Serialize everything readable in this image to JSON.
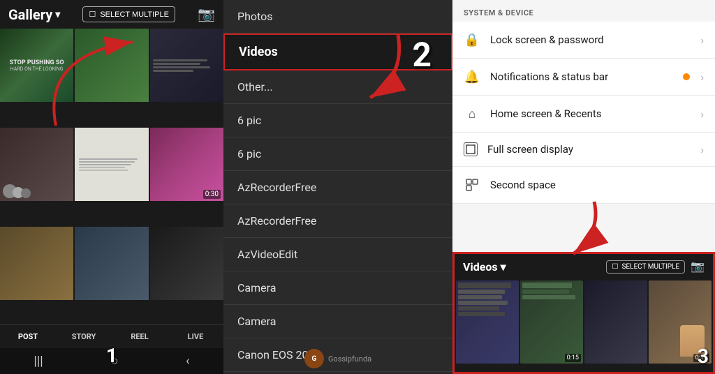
{
  "section1": {
    "header": {
      "title": "Gallery",
      "select_multiple": "SELECT MULTIPLE",
      "chevron": "▾"
    },
    "bottom_tabs": [
      "POST",
      "STORY",
      "REEL",
      "LIVE"
    ],
    "step_number": "1",
    "android_nav": [
      "|||",
      "○",
      "‹"
    ]
  },
  "section2": {
    "step_number": "2",
    "menu_items": [
      {
        "label": "Photos",
        "highlighted": false
      },
      {
        "label": "Videos",
        "highlighted": true
      },
      {
        "label": "Other...",
        "highlighted": false
      },
      {
        "label": "6 pic",
        "highlighted": false
      },
      {
        "label": "6 pic",
        "highlighted": false
      },
      {
        "label": "AzRecorderFree",
        "highlighted": false
      },
      {
        "label": "AzRecorderFree",
        "highlighted": false
      },
      {
        "label": "AzVideoEdit",
        "highlighted": false
      },
      {
        "label": "Camera",
        "highlighted": false
      },
      {
        "label": "Camera",
        "highlighted": false
      },
      {
        "label": "Canon EOS 200D",
        "highlighted": false
      }
    ],
    "watermark": "Gossipfunda"
  },
  "section3": {
    "section_label": "SYSTEM & DEVICE",
    "settings_items": [
      {
        "icon": "🔒",
        "label": "Lock screen & password",
        "has_chevron": true,
        "has_dot": false
      },
      {
        "icon": "🔔",
        "label": "Notifications & status bar",
        "has_chevron": true,
        "has_dot": false
      },
      {
        "icon": "⌂",
        "label": "Home screen & Recents",
        "has_chevron": true,
        "has_dot": false
      },
      {
        "icon": "⛶",
        "label": "Full screen display",
        "has_chevron": true,
        "has_dot": false
      },
      {
        "icon": "□",
        "label": "Second space",
        "has_chevron": false,
        "has_dot": false
      }
    ],
    "bottom_panel": {
      "title": "Videos",
      "chevron": "▾",
      "select_multiple": "SELECT MULTIPLE",
      "step_number": "3",
      "video_durations": [
        "0:15",
        "0:19"
      ]
    }
  }
}
